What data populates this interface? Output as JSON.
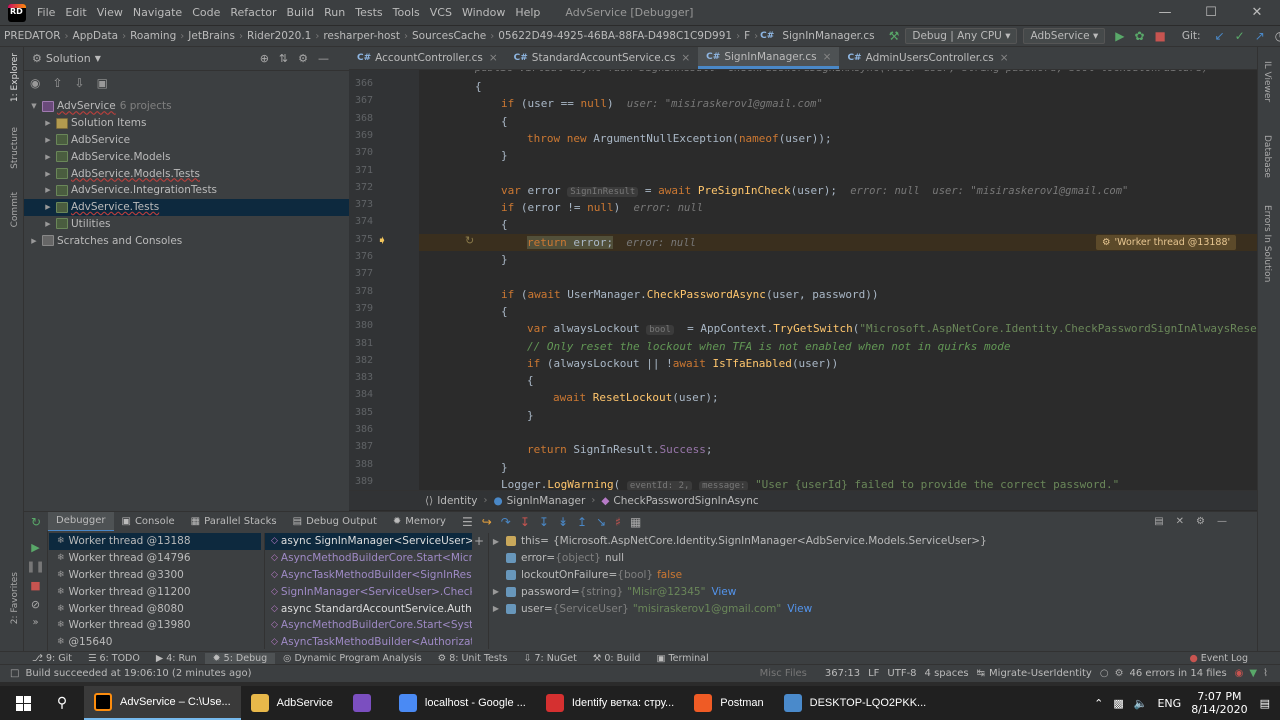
{
  "menubar": {
    "items": [
      "File",
      "Edit",
      "View",
      "Navigate",
      "Code",
      "Refactor",
      "Build",
      "Run",
      "Tests",
      "Tools",
      "VCS",
      "Window",
      "Help"
    ],
    "title": "AdvService [Debugger]"
  },
  "navbar": {
    "crumbs": [
      "PREDATOR",
      "AppData",
      "Roaming",
      "JetBrains",
      "Rider2020.1",
      "resharper-host",
      "SourcesCache",
      "05622D49-4925-46BA-88FA-D498C1C9D991",
      "F"
    ],
    "file": "SignInManager.cs",
    "config": "Debug | Any CPU",
    "run_target": "AdbService",
    "git_label": "Git:"
  },
  "sidebar": {
    "left_tabs": [
      "1: Explorer",
      "Structure",
      "Commit"
    ],
    "left_tabs_bottom": [
      "2: Favorites"
    ],
    "right_tabs": [
      "IL Viewer",
      "Database",
      "Errors In Solution"
    ]
  },
  "solution": {
    "header": "Solution",
    "root_label": "AdvService",
    "root_count": "6 projects",
    "items": [
      {
        "label": "Solution Items",
        "type": "folder"
      },
      {
        "label": "AdbService",
        "type": "project"
      },
      {
        "label": "AdbService.Models",
        "type": "project"
      },
      {
        "label": "AdbService.Models.Tests",
        "type": "project"
      },
      {
        "label": "AdvService.IntegrationTests",
        "type": "project"
      },
      {
        "label": "AdvService.Tests",
        "type": "project"
      },
      {
        "label": "Utilities",
        "type": "project"
      }
    ],
    "scratches": "Scratches and Consoles"
  },
  "editor_tabs": [
    {
      "label": "AccountController.cs",
      "active": false
    },
    {
      "label": "StandardAccountService.cs",
      "active": false
    },
    {
      "label": "SignInManager.cs",
      "active": true
    },
    {
      "label": "AdminUsersController.cs",
      "active": false
    }
  ],
  "code": {
    "line_numbers": [
      "366",
      "367",
      "368",
      "369",
      "370",
      "371",
      "372",
      "373",
      "374",
      "375",
      "376",
      "377",
      "378",
      "379",
      "380",
      "381",
      "382",
      "383",
      "384",
      "385",
      "386",
      "387",
      "388",
      "389"
    ],
    "top_partial": "public virtual async Task<SignInResult> CheckPasswordSignInAsync(TUser user, string password, bool lockoutOnFailure)",
    "l367_hint": "user: \"misiraskerov1@gmail.com\"",
    "l372_type_hint": "SignInResult",
    "l372_hint": "error: null  user: \"misiraskerov1@gmail.com\"",
    "l373_hint": "error: null",
    "l375_hint": "error: null",
    "l380_type_hint": "bool",
    "l380_string": "\"Microsoft.AspNetCore.Identity.CheckPasswordSignInAlwaysRese",
    "l381_comment": "// Only reset the lockout when TFA is not enabled when not in quirks mode",
    "l389_event_hint": "eventId: 2,",
    "l389_msg_hint": "message:",
    "l389_string": "\"User {userId} failed to provide the correct password.\"",
    "thread_tag": "'Worker thread @13188'"
  },
  "breadcrumb": {
    "items": [
      "Identity",
      "SignInManager",
      "CheckPasswordSignInAsync"
    ]
  },
  "debug": {
    "tabs": [
      "Debugger",
      "Console",
      "Parallel Stacks",
      "Debug Output",
      "Memory"
    ],
    "threads": [
      "Worker thread @13188",
      "Worker thread @14796",
      "Worker thread @3300",
      "Worker thread @11200",
      "Worker thread @8080",
      "Worker thread @13980",
      "@15640"
    ],
    "frames": [
      {
        "text": "async SignInManager<ServiceUser>.Chec",
        "sel": true
      },
      {
        "text": "AsyncMethodBuilderCore.Start<Microsof",
        "sel": false
      },
      {
        "text": "AsyncTaskMethodBuilder<SignInResult>.S",
        "sel": false
      },
      {
        "text": "SignInManager<ServiceUser>.CheckPassw",
        "sel": false
      },
      {
        "text": "async StandardAccountService.Authoriz",
        "sel": false
      },
      {
        "text": "AsyncMethodBuilderCore.Start<System._",
        "sel": false
      },
      {
        "text": "AsyncTaskMethodBuilder<AuthorizationR",
        "sel": false
      }
    ],
    "vars": [
      {
        "expand": true,
        "name": "this",
        "eq": " = ",
        "type": "",
        "value": "{Microsoft.AspNetCore.Identity.SignInManager<AdbService.Models.ServiceUser>}",
        "link": ""
      },
      {
        "expand": false,
        "name": "error",
        "eq": " = ",
        "type": "{object}",
        "value": "null",
        "link": ""
      },
      {
        "expand": false,
        "name": "lockoutOnFailure",
        "eq": " = ",
        "type": "{bool}",
        "value": "false",
        "link": ""
      },
      {
        "expand": true,
        "name": "password",
        "eq": " = ",
        "type": "{string}",
        "value": "\"Misir@12345\"",
        "link": "View"
      },
      {
        "expand": true,
        "name": "user",
        "eq": " = ",
        "type": "{ServiceUser}",
        "value": "\"misiraskerov1@gmail.com\"",
        "link": "View"
      }
    ]
  },
  "toolwindows": {
    "items": [
      "9: Git",
      "6: TODO",
      "4: Run",
      "5: Debug",
      "Dynamic Program Analysis",
      "8: Unit Tests",
      "7: NuGet",
      "0: Build",
      "Terminal"
    ],
    "event_log": "Event Log"
  },
  "status": {
    "message": "Build succeeded at 19:06:10 (2 minutes ago)",
    "misc": "Misc Files",
    "pos": "367:13",
    "lf": "LF",
    "enc": "UTF-8",
    "indent": "4 spaces",
    "branch": "Migrate-UserIdentity",
    "errors": "46 errors in 14 files"
  },
  "taskbar": {
    "apps": [
      {
        "label": "AdvService – C:\\Use...",
        "active": true,
        "color": "#000000"
      },
      {
        "label": "AdbService",
        "active": false,
        "color": "#e8b84a"
      },
      {
        "label": "",
        "active": false,
        "color": "#7b4fc0"
      },
      {
        "label": "localhost - Google ...",
        "active": false,
        "color": "#4a8af4"
      },
      {
        "label": "Identify ветка: стру...",
        "active": false,
        "color": "#d53030"
      },
      {
        "label": "Postman",
        "active": false,
        "color": "#ef5b25"
      },
      {
        "label": "DESKTOP-LQO2PKK...",
        "active": false,
        "color": "#4a8acb"
      }
    ],
    "lang": "ENG",
    "time": "7:07 PM",
    "date": "8/14/2020"
  }
}
